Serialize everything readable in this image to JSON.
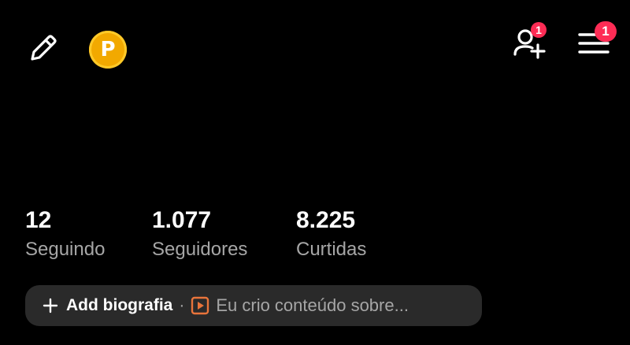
{
  "header": {
    "coin_letter": "P",
    "friend_badge": "1",
    "menu_badge": "1"
  },
  "stats": [
    {
      "value": "12",
      "label": "Seguindo"
    },
    {
      "value": "1.077",
      "label": "Seguidores"
    },
    {
      "value": "8.225",
      "label": "Curtidas"
    }
  ],
  "bio": {
    "add_label": "Add biografia",
    "separator": "·",
    "preview": "Eu crio conteúdo sobre..."
  },
  "icons": [
    "pencil-icon",
    "coin-icon",
    "add-friend-icon",
    "hamburger-menu-icon",
    "plus-icon",
    "play-icon"
  ],
  "colors": {
    "background": "#000000",
    "badge": "#fe2c55",
    "coin": "#f2a900",
    "pill": "#2a2a2a",
    "muted_text": "#a6a6a6",
    "play_accent": "#e8743b"
  }
}
